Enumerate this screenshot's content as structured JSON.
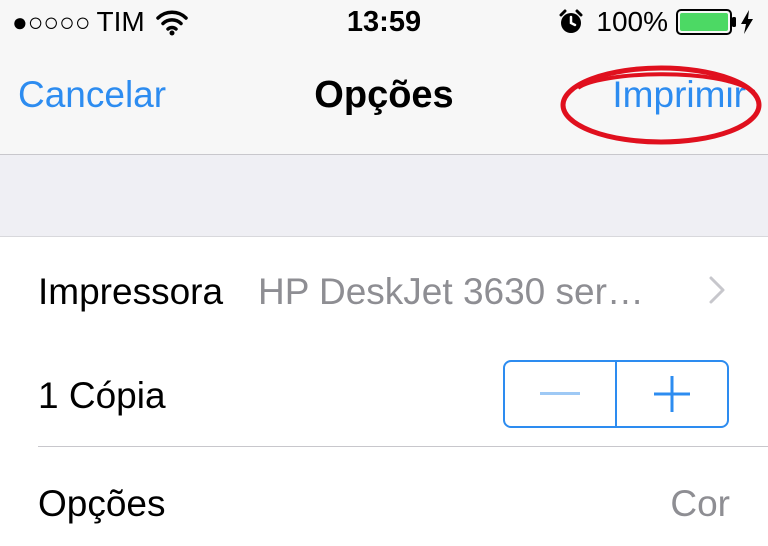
{
  "status": {
    "signal": "●○○○○",
    "carrier": "TIM",
    "time": "13:59",
    "battery_percent": "100%",
    "battery_level": 1.0,
    "icons": [
      "wifi-icon",
      "alarm-icon",
      "battery-icon",
      "charging-bolt-icon"
    ]
  },
  "nav": {
    "cancel_label": "Cancelar",
    "title": "Opções",
    "print_label": "Imprimir"
  },
  "rows": {
    "printer_label": "Impressora",
    "printer_value": "HP DeskJet 3630 ser…",
    "copies_label": "1 Cópia",
    "options_label": "Opções",
    "options_value": "Cor"
  },
  "colors": {
    "accent": "#2d8cf0",
    "annotation": "#e0101e",
    "battery": "#4cd964",
    "secondary_text": "#8e8e93"
  }
}
